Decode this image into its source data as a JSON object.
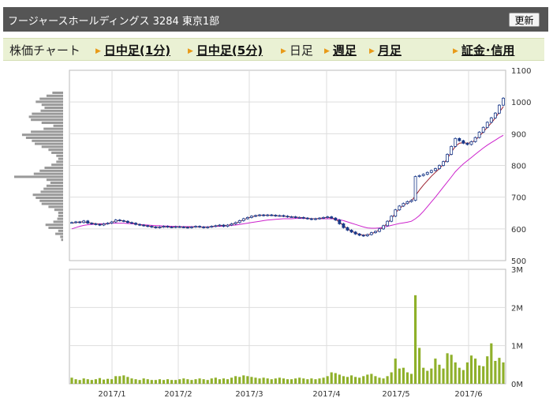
{
  "header": {
    "title": "フージャースホールディングス 3284 東京1部",
    "refresh_label": "更新"
  },
  "tabs": [
    {
      "label": "株価チャート",
      "link": false,
      "arrow": false
    },
    {
      "label": "日中足(1分)",
      "link": true,
      "arrow": true
    },
    {
      "label": "日中足(5分)",
      "link": true,
      "arrow": true
    },
    {
      "label": "日足",
      "link": false,
      "arrow": true
    },
    {
      "label": "週足",
      "link": true,
      "arrow": true
    },
    {
      "label": "月足",
      "link": true,
      "arrow": true
    },
    {
      "label": "証金･信用",
      "link": true,
      "arrow": true
    }
  ],
  "colors": {
    "up": "#ffffff",
    "down": "#1b3a8a",
    "ma_short": "#9b1f2f",
    "ma_long": "#cc22cc",
    "volume": "#8fb02a",
    "profile": "#999999"
  },
  "chart_data": [
    {
      "type": "candlestick",
      "title": "",
      "x_ticks": [
        "2017/1",
        "2017/2",
        "2017/3",
        "2017/4",
        "2017/5",
        "2017/6"
      ],
      "y_ticks": [
        500,
        600,
        700,
        800,
        900,
        1000,
        1100
      ],
      "ylim": [
        500,
        1100
      ],
      "grid": true,
      "series": [
        {
          "kind": "close",
          "values": [
            620,
            622,
            620,
            625,
            618,
            616,
            614,
            612,
            616,
            618,
            622,
            628,
            626,
            624,
            620,
            618,
            614,
            612,
            610,
            608,
            606,
            604,
            606,
            608,
            606,
            605,
            607,
            606,
            605,
            604,
            606,
            608,
            606,
            604,
            606,
            608,
            610,
            612,
            608,
            612,
            616,
            620,
            626,
            632,
            636,
            640,
            642,
            644,
            642,
            644,
            643,
            641,
            642,
            640,
            638,
            638,
            636,
            636,
            634,
            632,
            630,
            632,
            634,
            636,
            638,
            634,
            628,
            616,
            604,
            596,
            590,
            584,
            580,
            578,
            582,
            588,
            592,
            600,
            610,
            624,
            640,
            660,
            672,
            680,
            686,
            690,
            765,
            768,
            772,
            778,
            784,
            790,
            800,
            812,
            835,
            860,
            885,
            878,
            870,
            866,
            875,
            888,
            905,
            920,
            936,
            950,
            965,
            990,
            1012
          ]
        },
        {
          "kind": "ma_short",
          "values": [
            618,
            620,
            622,
            622,
            620,
            618,
            616,
            614,
            614,
            616,
            620,
            625,
            626,
            625,
            622,
            619,
            616,
            613,
            611,
            609,
            607,
            605,
            605,
            606,
            606,
            605,
            606,
            606,
            605,
            605,
            605,
            607,
            606,
            605,
            605,
            607,
            609,
            611,
            610,
            611,
            614,
            618,
            623,
            629,
            634,
            638,
            641,
            643,
            643,
            643,
            643,
            642,
            641,
            640,
            639,
            638,
            637,
            636,
            635,
            633,
            632,
            632,
            633,
            635,
            636,
            635,
            630,
            621,
            610,
            600,
            593,
            587,
            583,
            580,
            581,
            585,
            590,
            597,
            606,
            618,
            632,
            650,
            664,
            674,
            682,
            688,
            705,
            722,
            738,
            752,
            766,
            778,
            790,
            804,
            822,
            842,
            860,
            870,
            872,
            870,
            872,
            880,
            892,
            906,
            920,
            934,
            950,
            968,
            985
          ]
        },
        {
          "kind": "ma_long",
          "values": [
            600,
            604,
            608,
            611,
            613,
            614,
            615,
            616,
            616,
            617,
            618,
            618,
            618,
            618,
            617,
            616,
            615,
            614,
            613,
            612,
            611,
            610,
            610,
            609,
            609,
            608,
            608,
            607,
            607,
            607,
            607,
            607,
            606,
            606,
            606,
            607,
            608,
            608,
            609,
            610,
            611,
            612,
            614,
            616,
            618,
            620,
            622,
            624,
            626,
            628,
            629,
            630,
            631,
            632,
            632,
            632,
            633,
            633,
            633,
            633,
            632,
            632,
            632,
            632,
            632,
            632,
            631,
            629,
            626,
            622,
            618,
            614,
            610,
            606,
            603,
            602,
            602,
            603,
            605,
            608,
            611,
            614,
            617,
            619,
            621,
            624,
            632,
            642,
            655,
            670,
            685,
            700,
            716,
            732,
            748,
            764,
            780,
            793,
            805,
            815,
            825,
            835,
            845,
            855,
            864,
            872,
            880,
            888,
            895
          ]
        },
        {
          "kind": "volume_m",
          "values": [
            0.16,
            0.12,
            0.1,
            0.14,
            0.12,
            0.1,
            0.12,
            0.15,
            0.11,
            0.13,
            0.12,
            0.2,
            0.2,
            0.22,
            0.18,
            0.14,
            0.12,
            0.1,
            0.14,
            0.12,
            0.1,
            0.1,
            0.12,
            0.1,
            0.12,
            0.1,
            0.1,
            0.12,
            0.14,
            0.12,
            0.1,
            0.12,
            0.14,
            0.12,
            0.1,
            0.14,
            0.16,
            0.12,
            0.14,
            0.12,
            0.16,
            0.2,
            0.18,
            0.22,
            0.2,
            0.18,
            0.16,
            0.14,
            0.16,
            0.14,
            0.12,
            0.14,
            0.16,
            0.14,
            0.12,
            0.12,
            0.14,
            0.16,
            0.14,
            0.12,
            0.14,
            0.12,
            0.14,
            0.16,
            0.2,
            0.3,
            0.28,
            0.24,
            0.2,
            0.18,
            0.22,
            0.18,
            0.16,
            0.2,
            0.24,
            0.26,
            0.2,
            0.16,
            0.14,
            0.2,
            0.3,
            0.66,
            0.4,
            0.42,
            0.3,
            0.26,
            2.32,
            0.94,
            0.42,
            0.34,
            0.4,
            0.66,
            0.5,
            0.4,
            0.8,
            0.76,
            0.56,
            0.42,
            0.36,
            0.56,
            0.74,
            0.66,
            0.48,
            0.46,
            0.72,
            1.06,
            0.6,
            0.68,
            0.56
          ]
        }
      ]
    },
    {
      "type": "bar",
      "title": "",
      "y_ticks": [
        "0M",
        "1M",
        "2M",
        "3M"
      ],
      "ylim": [
        0,
        3
      ]
    },
    {
      "type": "bar",
      "orientation": "horizontal",
      "title": "",
      "values": [
        0.22,
        0.34,
        0.48,
        0.56,
        0.44,
        0.38,
        0.46,
        0.64,
        0.7,
        0.66,
        0.44,
        0.2,
        0.4,
        0.66,
        0.84,
        0.76,
        0.64,
        0.58,
        0.44,
        0.3,
        0.24,
        0.14,
        0.1,
        0.14,
        0.24,
        0.38,
        0.48,
        0.6,
        1.0,
        0.34,
        0.26,
        0.34,
        0.4,
        0.46,
        0.62,
        0.56,
        0.48,
        0.44,
        0.3,
        0.18,
        0.1,
        0.1,
        0.12,
        0.2,
        0.36,
        0.3,
        0.1,
        0.16,
        0.06,
        0.04
      ]
    }
  ]
}
